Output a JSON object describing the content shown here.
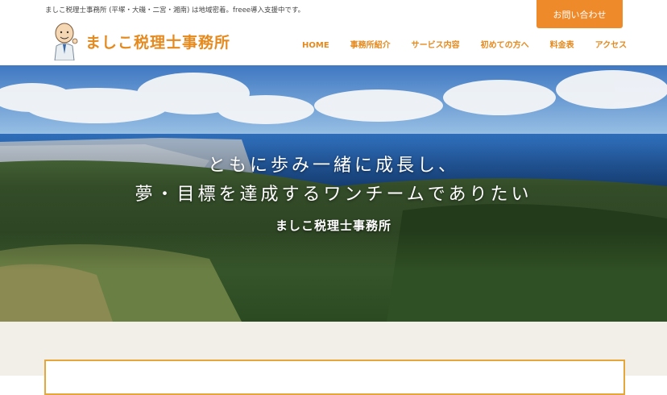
{
  "header": {
    "tagline": "ましこ税理士事務所 (平塚・大磯・二宮・湘南) は地域密着。freee導入支援中です。",
    "contact_label": "お問い合わせ",
    "logo_text": "ましこ税理士事務所"
  },
  "nav": {
    "items": [
      {
        "label": "HOME",
        "active": true
      },
      {
        "label": "事務所紹介"
      },
      {
        "label": "サービス内容"
      },
      {
        "label": "初めての方へ"
      },
      {
        "label": "料金表"
      },
      {
        "label": "アクセス"
      }
    ]
  },
  "hero": {
    "line1": "ともに歩み一緒に成長し、",
    "line2": "夢・目標を達成するワンチームでありたい",
    "subtitle": "ましこ税理士事務所"
  },
  "colors": {
    "accent": "#e58a1f",
    "contact_bg": "#ee8a2a",
    "section_bg": "#f2eee8",
    "box_border": "#e5a63c"
  }
}
